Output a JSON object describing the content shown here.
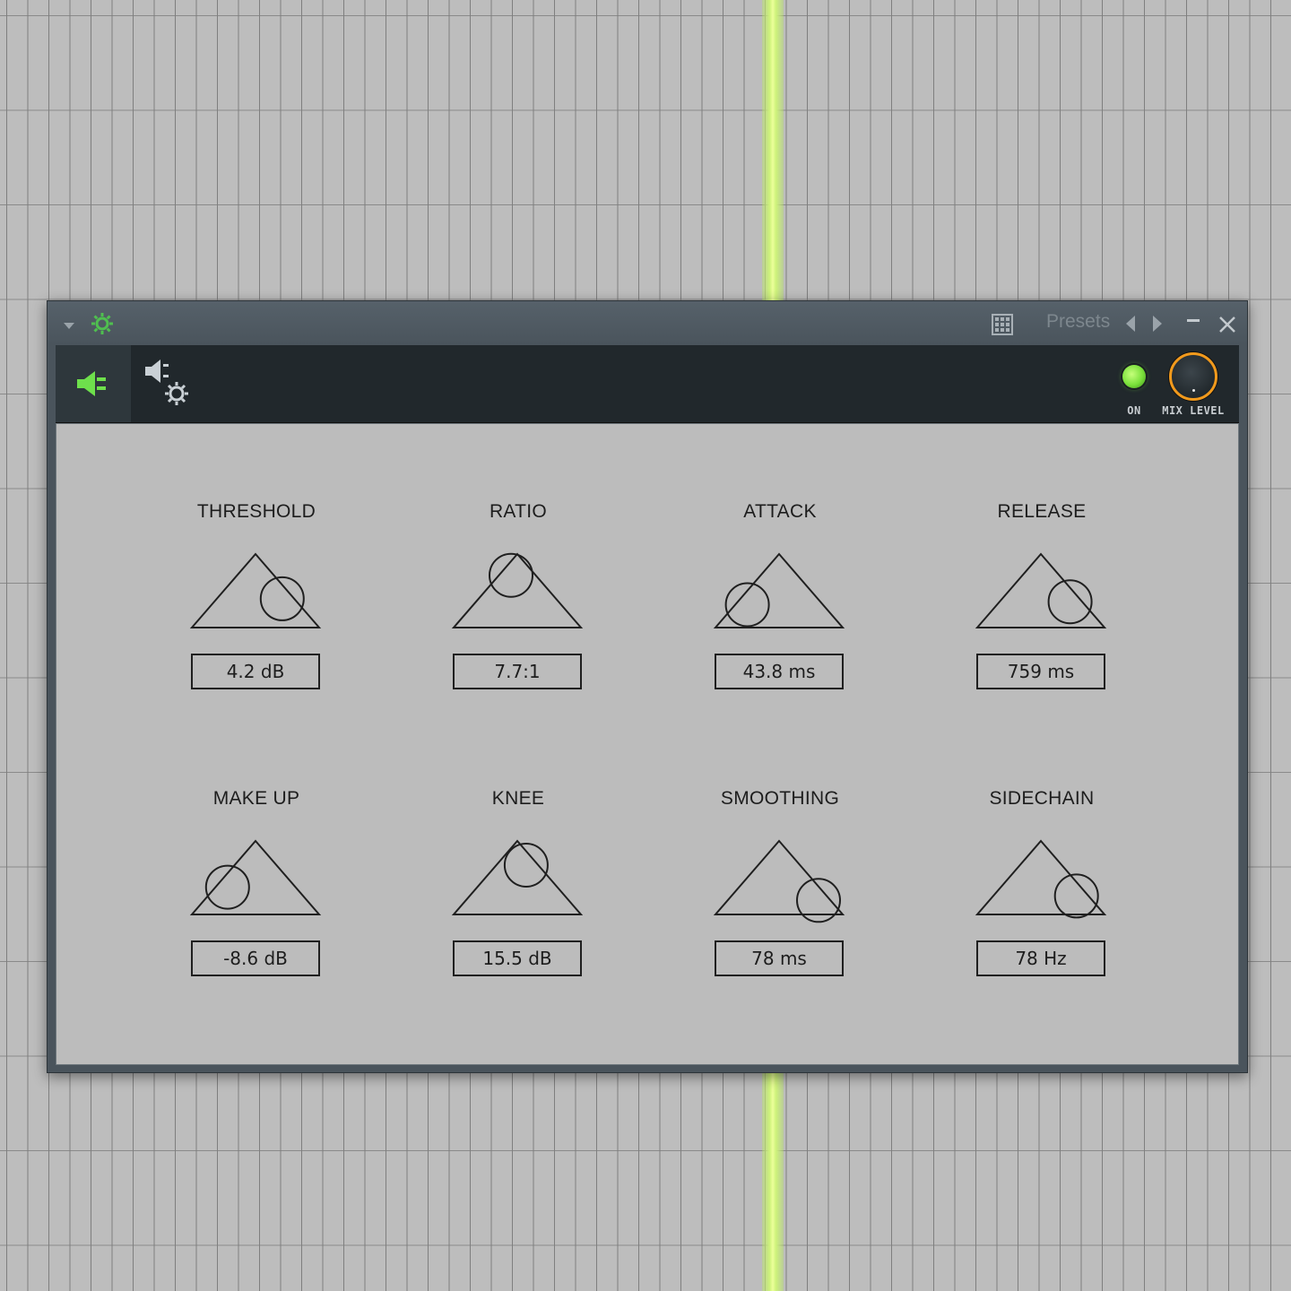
{
  "titlebar": {
    "presets_label": "Presets"
  },
  "toolbar": {
    "on_label": "ON",
    "mix_label": "MIX LEVEL",
    "on_state": true,
    "accent_color": "#f29a1c",
    "led_color": "#7be23c"
  },
  "params": [
    {
      "label": "THRESHOLD",
      "value": "4.2 dB",
      "knob_position": 0.78
    },
    {
      "label": "RATIO",
      "value": "7.7:1",
      "knob_position": 0.38
    },
    {
      "label": "ATTACK",
      "value": "43.8 ms",
      "knob_position": 0.18
    },
    {
      "label": "RELEASE",
      "value": "759 ms",
      "knob_position": 0.8
    },
    {
      "label": "MAKE UP",
      "value": "-8.6 dB",
      "knob_position": 0.21
    },
    {
      "label": "KNEE",
      "value": "15.5 dB",
      "knob_position": 0.64
    },
    {
      "label": "SMOOTHING",
      "value": "78 ms",
      "knob_position": 0.88
    },
    {
      "label": "SIDECHAIN",
      "value": "78 Hz",
      "knob_position": 0.85
    }
  ]
}
